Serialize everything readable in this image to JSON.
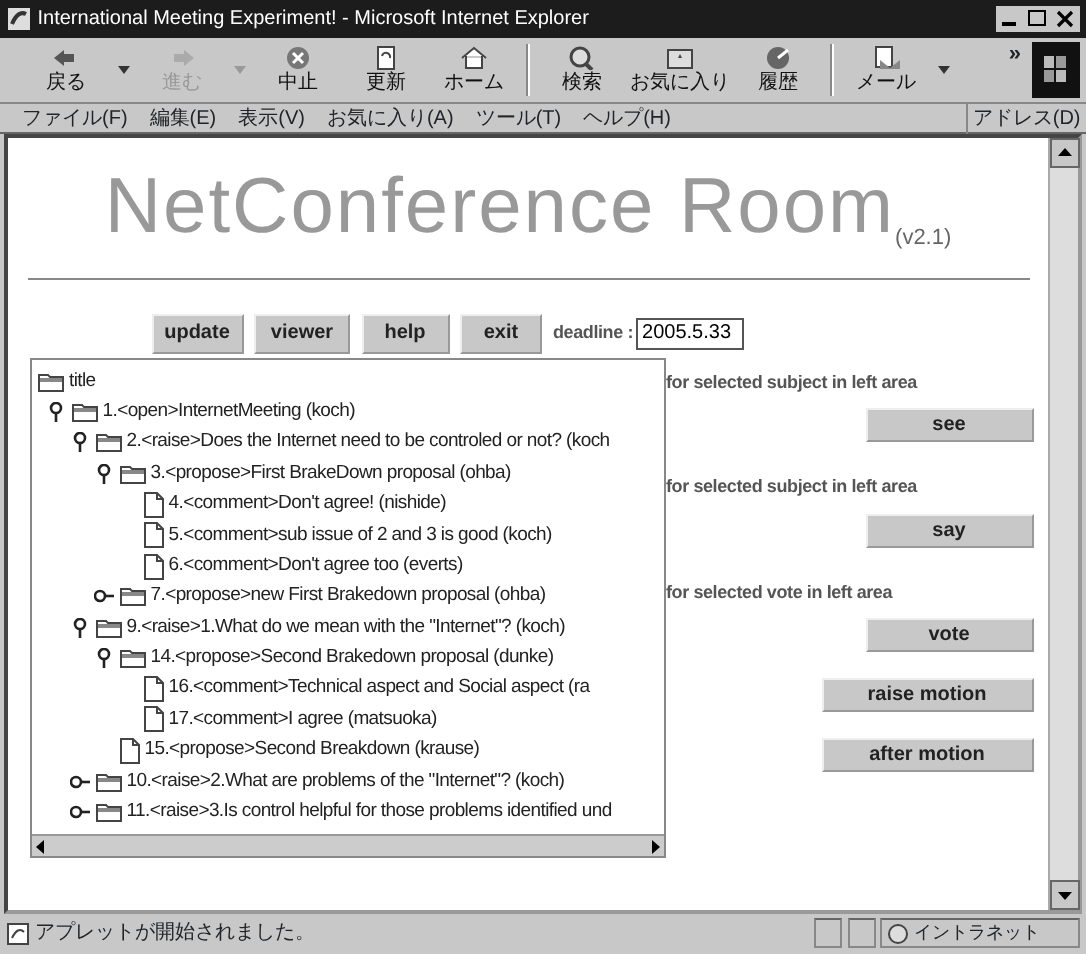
{
  "window": {
    "title": "International Meeting Experiment! - Microsoft Internet Explorer"
  },
  "toolbar": {
    "buttons": [
      {
        "label": "戻る",
        "disabled": false,
        "dropdown": true
      },
      {
        "label": "進む",
        "disabled": true,
        "dropdown": true
      },
      {
        "label": "中止",
        "disabled": false,
        "dropdown": false
      },
      {
        "label": "更新",
        "disabled": false,
        "dropdown": false
      },
      {
        "label": "ホーム",
        "disabled": false,
        "dropdown": false
      },
      {
        "label": "検索",
        "disabled": false,
        "dropdown": false
      },
      {
        "label": "お気に入り",
        "disabled": false,
        "dropdown": false
      },
      {
        "label": "履歴",
        "disabled": false,
        "dropdown": false
      },
      {
        "label": "メール",
        "disabled": false,
        "dropdown": true
      }
    ],
    "overflow": "»"
  },
  "menu": {
    "items": [
      "ファイル(F)",
      "編集(E)",
      "表示(V)",
      "お気に入り(A)",
      "ツール(T)",
      "ヘルプ(H)"
    ],
    "address_label": "アドレス(D)"
  },
  "page": {
    "title": "NetConference Room",
    "version": "(v2.1)",
    "buttons": [
      "update",
      "viewer",
      "help",
      "exit"
    ],
    "deadline_label": "deadline :",
    "deadline_value": "2005.5.33",
    "tree": {
      "label": "title",
      "kind": "folder",
      "children": [
        {
          "label": "1.<open>InternetMeeting (koch)",
          "kind": "folder",
          "expanded": true,
          "children": [
            {
              "label": "2.<raise>Does the Internet need to be controled or not? (koch",
              "kind": "folder",
              "expanded": true,
              "children": [
                {
                  "label": "3.<propose>First BrakeDown proposal (ohba)",
                  "kind": "folder",
                  "expanded": true,
                  "children": [
                    {
                      "label": "4.<comment>Don't agree! (nishide)",
                      "kind": "doc"
                    },
                    {
                      "label": "5.<comment>sub issue of 2 and 3 is good (koch)",
                      "kind": "doc"
                    },
                    {
                      "label": "6.<comment>Don't agree too (everts)",
                      "kind": "doc"
                    }
                  ]
                },
                {
                  "label": "7.<propose>new First Brakedown proposal (ohba)",
                  "kind": "folder",
                  "expanded": false
                }
              ]
            },
            {
              "label": "9.<raise>1.What do we mean with the \"Internet\"? (koch)",
              "kind": "folder",
              "expanded": true,
              "children": [
                {
                  "label": "14.<propose>Second Brakedown proposal (dunke)",
                  "kind": "folder",
                  "expanded": true,
                  "children": [
                    {
                      "label": "16.<comment>Technical aspect and Social aspect (ra",
                      "kind": "doc"
                    },
                    {
                      "label": "17.<comment>I agree (matsuoka)",
                      "kind": "doc"
                    }
                  ]
                },
                {
                  "label": "15.<propose>Second Breakdown (krause)",
                  "kind": "doc"
                }
              ]
            },
            {
              "label": "10.<raise>2.What are problems of the \"Internet\"? (koch)",
              "kind": "folder",
              "expanded": false
            },
            {
              "label": "11.<raise>3.Is control helpful for those problems identified und",
              "kind": "folder",
              "expanded": false
            }
          ]
        }
      ]
    },
    "actions": [
      {
        "kind": "label",
        "text": "for selected subject in left area"
      },
      {
        "kind": "button",
        "text": "see"
      },
      {
        "kind": "label",
        "text": "for selected subject in left area"
      },
      {
        "kind": "button",
        "text": "say"
      },
      {
        "kind": "label",
        "text": "for selected vote in left area"
      },
      {
        "kind": "button",
        "text": "vote"
      },
      {
        "kind": "wide-button",
        "text": "raise motion"
      },
      {
        "kind": "wide-button",
        "text": "after motion"
      }
    ]
  },
  "status_bar": {
    "text": "アプレットが開始されました。",
    "zone": "イントラネット"
  }
}
